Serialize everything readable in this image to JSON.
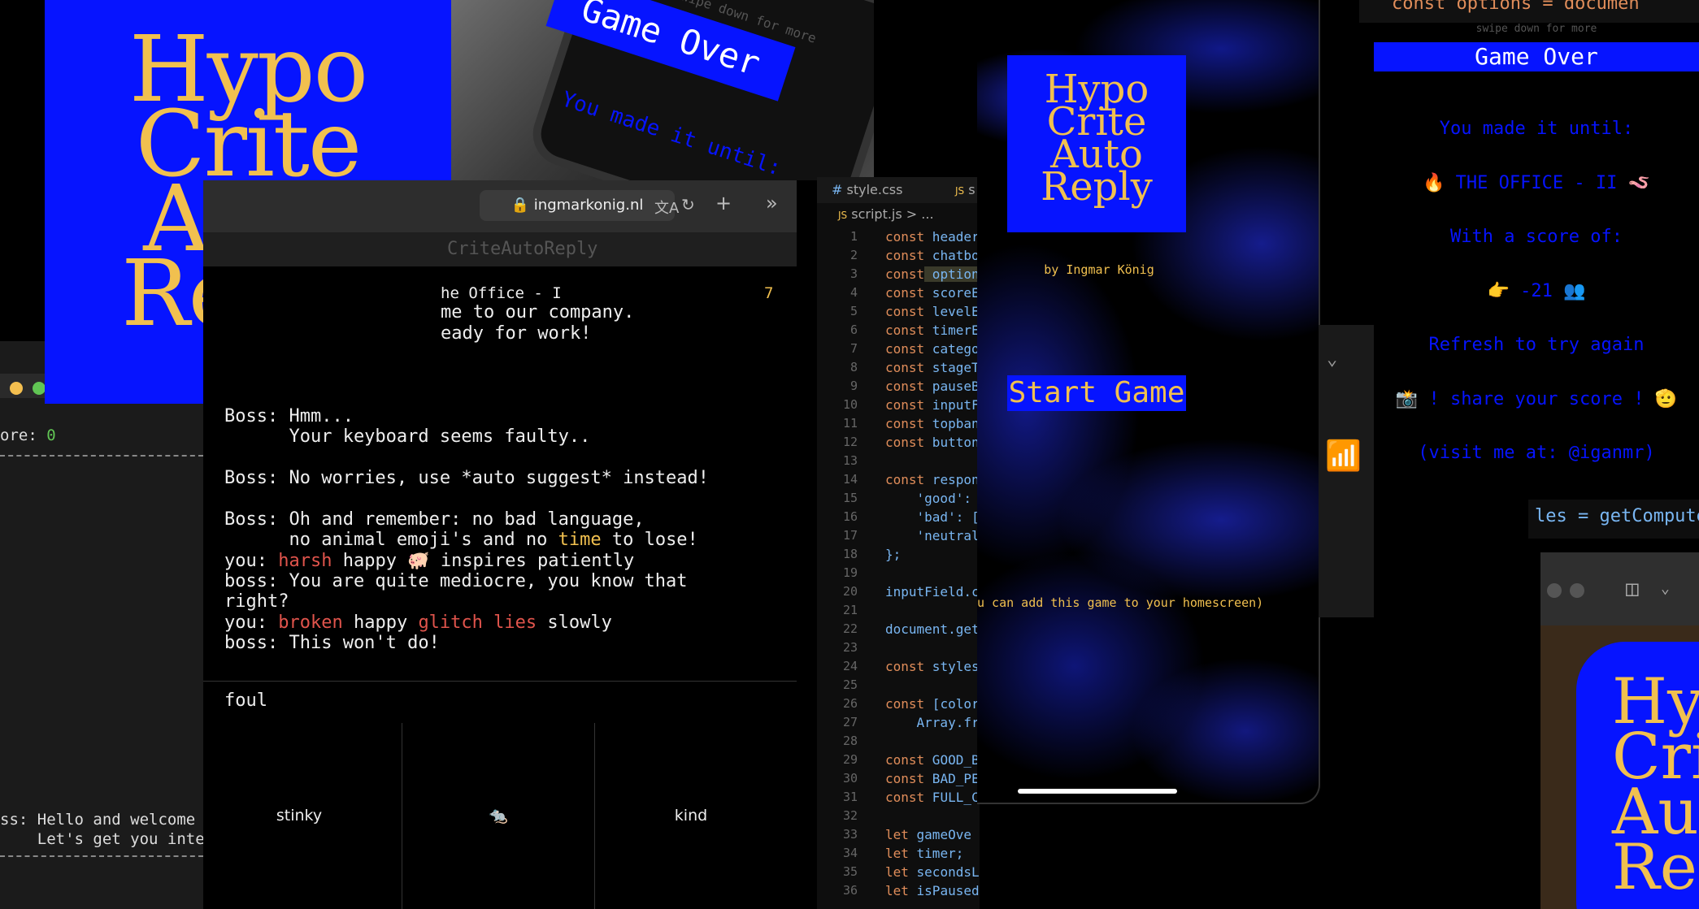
{
  "logo": {
    "lines": [
      "Hypo",
      "Crite",
      "Auto",
      "Reply"
    ],
    "bg_color": "#0614ff",
    "text_color": "#f1c04f"
  },
  "left_terminal": {
    "score_label": "ore:",
    "score_value": "0",
    "boss_line1": "ss: Hello and welcome",
    "boss_line2": "    Let's get you inte"
  },
  "phone_photo": {
    "swipe_text": "swipe down for more",
    "banner": "Game Over",
    "subtext": "You made it until:"
  },
  "browser": {
    "url": "ingmarkonig.nl",
    "tab_title": "CriteAutoReply",
    "level_title": "he Office - I",
    "timer": "7",
    "chat": {
      "line1": "me to our company.",
      "line2": "eady for work!",
      "boss1a": "Boss: Hmm...",
      "boss1b": "      Your keyboard seems faulty..",
      "boss2": "Boss: No worries, use *auto suggest* instead!",
      "boss3a": "Boss: Oh and remember: no bad language,",
      "boss3b_pre": "      no animal emoji's and no ",
      "boss3b_hl": "time",
      "boss3b_post": " to lose!",
      "you1_pre": "you: ",
      "you1_w1": "harsh",
      "you1_mid": " happy 🐖 inspires patiently",
      "boss4a": "boss: You are quite mediocre, you know that",
      "boss4b": "right?",
      "you2_pre": "you: ",
      "you2_w1": "broken",
      "you2_mid": " happy ",
      "you2_w2": "glitch",
      "you2_w3": "lies",
      "you2_post": " slowly",
      "boss5": "boss: This won't do!"
    },
    "input_value": "foul",
    "options": [
      "stinky",
      "🐀",
      "kind"
    ]
  },
  "editor": {
    "tab_css": "style.css",
    "tab_js": "s",
    "breadcrumb": "script.js > ...",
    "lines": [
      {
        "n": "1",
        "kw": "const",
        "rest": " header"
      },
      {
        "n": "2",
        "kw": "const",
        "rest": " chatbo"
      },
      {
        "n": "3",
        "kw": "const",
        "rest": " option"
      },
      {
        "n": "4",
        "kw": "const",
        "rest": " scoreE"
      },
      {
        "n": "5",
        "kw": "const",
        "rest": " levelE"
      },
      {
        "n": "6",
        "kw": "const",
        "rest": " timerE"
      },
      {
        "n": "7",
        "kw": "const",
        "rest": " catego"
      },
      {
        "n": "8",
        "kw": "const",
        "rest": " stageT"
      },
      {
        "n": "9",
        "kw": "const",
        "rest": " pauseB"
      },
      {
        "n": "10",
        "kw": "const",
        "rest": " inputF"
      },
      {
        "n": "11",
        "kw": "const",
        "rest": " topban"
      },
      {
        "n": "12",
        "kw": "const",
        "rest": " button"
      },
      {
        "n": "13",
        "kw": "",
        "rest": ""
      },
      {
        "n": "14",
        "kw": "const",
        "rest": " respon"
      },
      {
        "n": "15",
        "kw": "",
        "rest": "    'good':"
      },
      {
        "n": "16",
        "kw": "",
        "rest": "    'bad': ["
      },
      {
        "n": "17",
        "kw": "",
        "rest": "    'neutral"
      },
      {
        "n": "18",
        "kw": "",
        "rest": "};"
      },
      {
        "n": "19",
        "kw": "",
        "rest": ""
      },
      {
        "n": "20",
        "kw": "",
        "rest": "inputField.c"
      },
      {
        "n": "21",
        "kw": "",
        "rest": ""
      },
      {
        "n": "22",
        "kw": "",
        "rest": "document.get"
      },
      {
        "n": "23",
        "kw": "",
        "rest": ""
      },
      {
        "n": "24",
        "kw": "const",
        "rest": " styles"
      },
      {
        "n": "25",
        "kw": "",
        "rest": ""
      },
      {
        "n": "26",
        "kw": "const",
        "rest": " [color"
      },
      {
        "n": "27",
        "kw": "",
        "rest": "    Array.fr"
      },
      {
        "n": "28",
        "kw": "",
        "rest": ""
      },
      {
        "n": "29",
        "kw": "const",
        "rest": " GOOD_B"
      },
      {
        "n": "30",
        "kw": "const",
        "rest": " BAD_PE"
      },
      {
        "n": "31",
        "kw": "const",
        "rest": " FULL_C"
      },
      {
        "n": "32",
        "kw": "",
        "rest": ""
      },
      {
        "n": "33",
        "kw": "let",
        "rest": " gameOve"
      },
      {
        "n": "34",
        "kw": "let",
        "rest": " timer;"
      },
      {
        "n": "35",
        "kw": "let",
        "rest": " secondsL"
      },
      {
        "n": "36",
        "kw": "let",
        "rest": " isPaused"
      }
    ]
  },
  "phone_start": {
    "byline": "by Ingmar König",
    "start_button": "Start Game",
    "hint": "u can add this game to your homescreen)"
  },
  "gameover": {
    "swipe_text": "swipe down for more",
    "title": "Game Over",
    "made_it": "You made it until:",
    "stage": "🔥 THE OFFICE - II 🪱",
    "score_label": "With a score of:",
    "score": "👉 -21 👥",
    "refresh": "Refresh to try again",
    "share": "📸 ! share your score ! 🫡",
    "visit": "(visit me at: @iganmr)"
  },
  "code_top_right": "const options = documen",
  "code_mid_right": "les = getCompute"
}
